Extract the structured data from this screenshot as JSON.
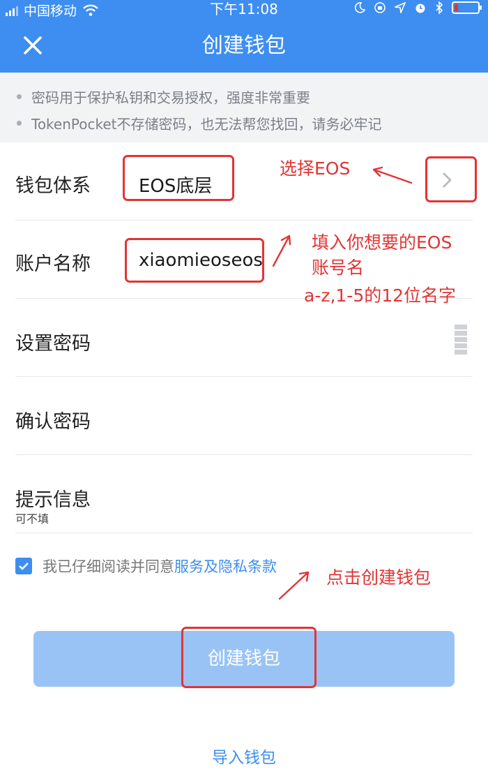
{
  "status_bar": {
    "carrier": "中国移动",
    "time": "下午11:08"
  },
  "header": {
    "title": "创建钱包"
  },
  "notice": {
    "lines": [
      "密码用于保护私钥和交易授权，强度非常重要",
      "TokenPocket不存储密码，也无法帮您找回，请务必牢记"
    ]
  },
  "form": {
    "wallet_system": {
      "label": "钱包体系",
      "value": "EOS底层"
    },
    "account_name": {
      "label": "账户名称",
      "value": "xiaomieoseos"
    },
    "set_password": {
      "label": "设置密码"
    },
    "confirm_password": {
      "label": "确认密码"
    },
    "hint": {
      "label": "提示信息",
      "sublabel": "可不填"
    }
  },
  "agreement": {
    "text": "我已仔细阅读并同意",
    "link": "服务及隐私条款",
    "checked": true
  },
  "create_button": {
    "label": "创建钱包"
  },
  "import_link": {
    "label": "导入钱包"
  },
  "annotations": {
    "select_eos": "选择EOS",
    "fill_name_line1": "填入你想要的EOS",
    "fill_name_line2": "账号名",
    "fill_name_line3": "a-z,1-5的12位名字",
    "click_create": "点击创建钱包"
  },
  "colors": {
    "primary": "#3d8ef0",
    "button_disabled": "#9ac3f5",
    "annotation_red": "#e23434",
    "notice_bg": "#f2f3f5"
  }
}
